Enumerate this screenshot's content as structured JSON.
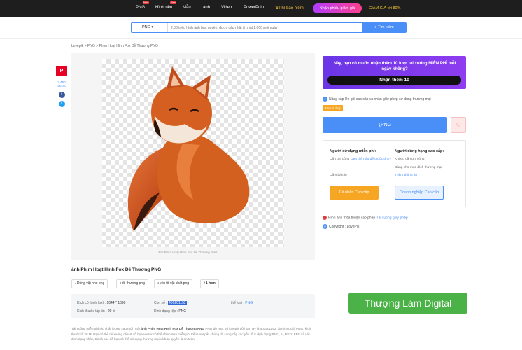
{
  "nav": {
    "items": [
      "PNG",
      "Hình nền",
      "Mẫu",
      "ảnh",
      "Video",
      "PowerPoint"
    ],
    "badges": {
      "png": "New",
      "hinhnen": "New"
    },
    "free_download": "Phí bảo hiểm",
    "promo_button": "Nhận phiếu giảm giá",
    "promo_text": "GIẢM GIÁ tới 80%"
  },
  "search": {
    "select_value": "PNG",
    "placeholder": "2.08 triệu hình ảnh bản quyền, được cập nhật ít nhất 1.000 mỗi ngày",
    "button": "Tìm kiếm"
  },
  "breadcrumb": "Lovepik > PNG > Phim Hoạt Hình Fox Dễ Thương PNG",
  "share": {
    "pinterest": "P",
    "count": "2,450",
    "count_label": "share",
    "facebook": "f",
    "twitter": "t"
  },
  "image": {
    "caption": "ảnh Phim Hoạt Hình Fox Dễ Thương PNG"
  },
  "title": "ảnh Phim Hoạt Hình Fox Dễ Thương PNG",
  "tags": [
    "Động vật nhỏ png",
    "dễ thương png",
    "yếu tố vật chất png",
    "+1 hơn"
  ],
  "details": {
    "size_label": "Kích cỡ hình (px) :",
    "size_value": "1044 * 1090",
    "id_label": "Con số :",
    "id_value": "400201152",
    "type_label": "thể loại :",
    "type_value": "PNG",
    "filesize_label": "Kích thước tập tin :",
    "filesize_value": "20 M",
    "format_label": "Định dạng tệp :",
    "format_value": "PNG"
  },
  "description": {
    "prefix": "Tải xuống miễn phí tệp chất lượng cao mới nhất ",
    "bold": "ảnh Phim Hoạt Hình Fox Dễ Thương PNG",
    "rest": " PNG đồ họa, số lovepik đồ họa này là 400201152, danh mục là PNG, kích thước là 20 M. Bạn có thể tải xuống clipart đồ họa vector có thể chỉnh sửa miễn phí trên Lovepik, chúng tôi cung cấp các yếu tố ở định dạng PNG, AI, PSD, EPS và các định dạng khác, tất cả các đồ họa có thể sử dụng thương mại và bản quyền là an toàn."
  },
  "watermark": "Thượng Làm Digital",
  "promo_box": {
    "text": "Này, bạn có muốn nhận thêm 10 lượt tải xuống MIỄN PHÍ mỗi ngày không?",
    "button": "Nhận thêm 10"
  },
  "upgrade": {
    "text": "Nâng cấp lên gói cao cấp và nhận giấy phép sử dụng thương mại",
    "tag": "Xem tổ hợp"
  },
  "download_button": "PNG",
  "license": {
    "free_title": "Người sử dụng miễn phí:",
    "free_line1": "Cần ghi công",
    "free_link": "Làm thế nào để thuộc tính?",
    "free_line2": "Cấm bán in",
    "pro_title": "Người dùng hạng cao cấp:",
    "pro_line1": "Không cần ghi công",
    "pro_line2": "Dùng cho mục đích thương mại",
    "pro_link": "Thêm thông tin",
    "free_btn": "Cá nhân Cao cấp",
    "pro_btn": "Doanh nghiệp Cao cấp"
  },
  "footer": {
    "license_text": "Hình ảnh thỏa thuận cấp phép",
    "license_link": "Tải xuống giấy phép",
    "copyright": "Copyright : LovePik"
  },
  "colors": {
    "accent": "#4a8ef7",
    "topbar": "#1e1e1e",
    "promo": "#7a38ea",
    "orange": "#f6a623",
    "watermark": "#4ab246"
  }
}
